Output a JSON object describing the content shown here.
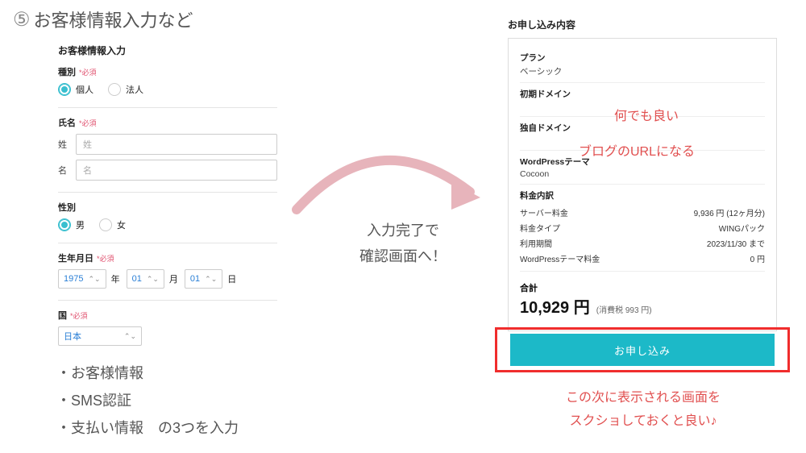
{
  "step": {
    "number": "⑤",
    "title": "お客様情報入力など"
  },
  "form": {
    "heading": "お客様情報入力",
    "required_text": "*必須",
    "type": {
      "label": "種別",
      "opt_personal": "個人",
      "opt_corp": "法人"
    },
    "name": {
      "label": "氏名",
      "sei_label": "姓",
      "mei_label": "名",
      "sei_placeholder": "姓",
      "mei_placeholder": "名"
    },
    "gender": {
      "label": "性別",
      "male": "男",
      "female": "女"
    },
    "dob": {
      "label": "生年月日",
      "year": "1975",
      "month": "01",
      "day": "01",
      "year_unit": "年",
      "month_unit": "月",
      "day_unit": "日"
    },
    "country": {
      "label": "国",
      "value": "日本"
    }
  },
  "bullets": {
    "b1": "お客様情報",
    "b2": "SMS認証",
    "b3": "支払い情報　の3つを入力"
  },
  "mid_caption": {
    "line1": "入力完了で",
    "line2": "確認画面へ！"
  },
  "summary": {
    "title": "お申し込み内容",
    "plan_label": "プラン",
    "plan_value": "ベーシック",
    "init_domain_label": "初期ドメイン",
    "own_domain_label": "独自ドメイン",
    "theme_label": "WordPressテーマ",
    "theme_value": "Cocoon",
    "price_label": "料金内訳",
    "rows": {
      "server_label": "サーバー料金",
      "server_value": "9,936 円 (12ヶ月分)",
      "plan_type_label": "料金タイプ",
      "plan_type_value": "WINGパック",
      "period_label": "利用期間",
      "period_value": "2023/11/30 まで",
      "theme_fee_label": "WordPressテーマ料金",
      "theme_fee_value": "0 円"
    },
    "total_label": "合計",
    "total_amount": "10,929 円",
    "total_tax": "(消費税 993 円)"
  },
  "annotations": {
    "init_domain": "何でも良い",
    "own_domain": "ブログのURLになる",
    "bottom_line1": "この次に表示される画面を",
    "bottom_line2": "スクショしておくと良い♪"
  },
  "submit": {
    "label": "お申し込み"
  }
}
